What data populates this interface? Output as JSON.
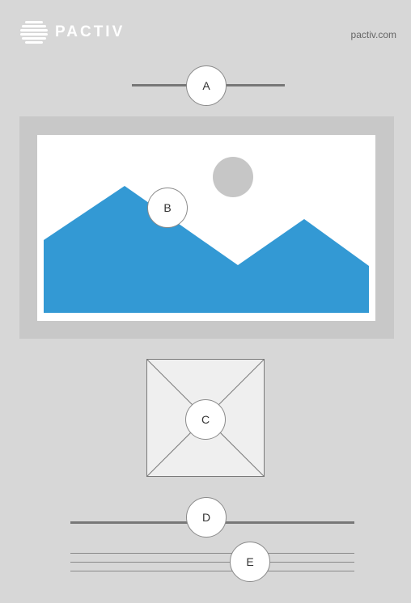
{
  "header": {
    "brand": "PACTIV",
    "url": "pactiv.com"
  },
  "markers": {
    "a": "A",
    "b": "B",
    "c": "C",
    "d": "D",
    "e": "E"
  },
  "colors": {
    "background": "#d7d7d7",
    "mountain": "#3399d4",
    "sun": "#c6c6c6",
    "frame": "#c8c8c8"
  }
}
